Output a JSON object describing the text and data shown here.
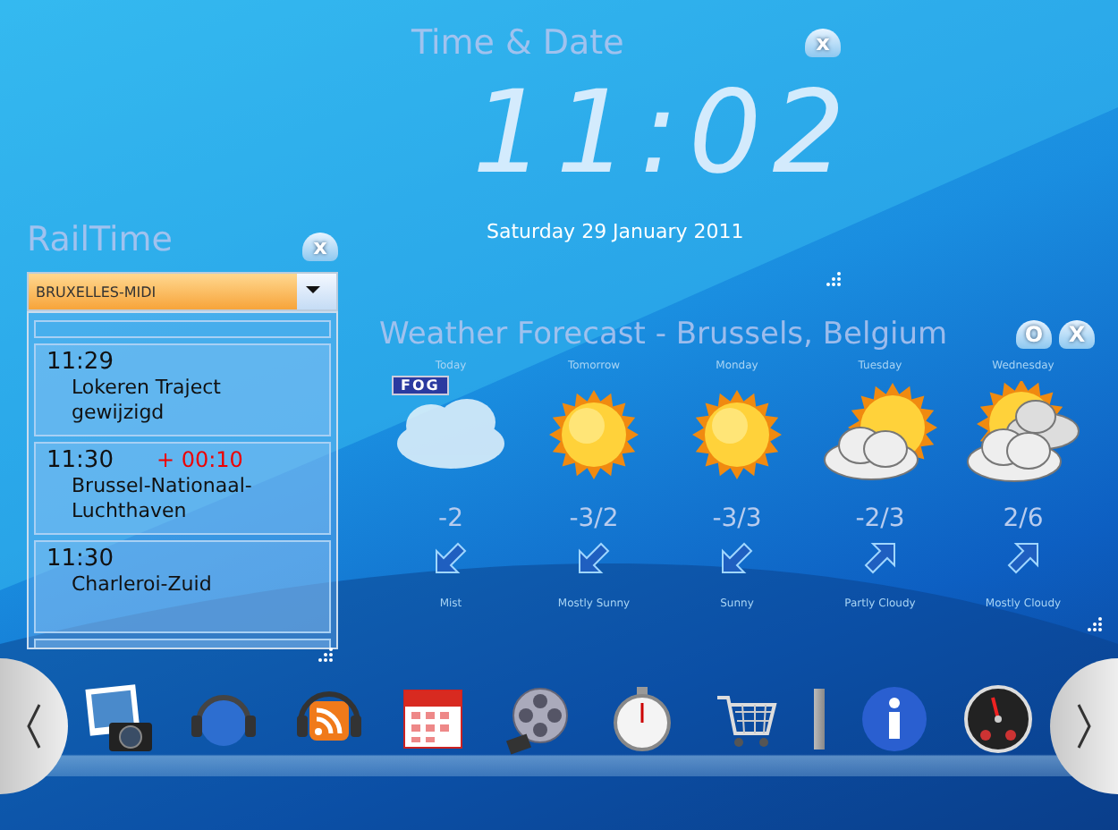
{
  "clock_widget": {
    "title": "Time & Date",
    "close": "x",
    "time": "11:02",
    "date": "Saturday 29 January 2011"
  },
  "railtime_widget": {
    "title": "RailTime",
    "close": "x",
    "station": "BRUXELLES-MIDI",
    "departures": [
      {
        "time": "11:29",
        "destination": "Lokeren Traject gewijzigd"
      },
      {
        "time": "11:30",
        "delay": "+ 00:10",
        "destination": "Brussel-Nationaal-Luchthaven"
      },
      {
        "time": "11:30",
        "destination": "Charleroi-Zuid"
      }
    ]
  },
  "weather_widget": {
    "title": "Weather Forecast - Brussels, Belgium",
    "buttons": [
      "O",
      "X"
    ],
    "days": [
      {
        "day": "Today",
        "badge": "FOG",
        "kind": "fog",
        "temperature": "-2",
        "wind": {
          "kind": "sw"
        },
        "condition": "Mist"
      },
      {
        "day": "Tomorrow",
        "kind": "sun",
        "temperature": "-3/2",
        "wind": {
          "kind": "sw"
        },
        "condition": "Mostly Sunny"
      },
      {
        "day": "Monday",
        "kind": "sun",
        "temperature": "-3/3",
        "wind": {
          "kind": "sw"
        },
        "condition": "Sunny"
      },
      {
        "day": "Tuesday",
        "kind": "partly-cloudy",
        "temperature": "-2/3",
        "wind": {
          "kind": "ne"
        },
        "condition": "Partly Cloudy"
      },
      {
        "day": "Wednesday",
        "kind": "mostly-cloudy",
        "temperature": "2/6",
        "wind": {
          "kind": "ne"
        },
        "condition": "Mostly Cloudy"
      }
    ]
  }
}
